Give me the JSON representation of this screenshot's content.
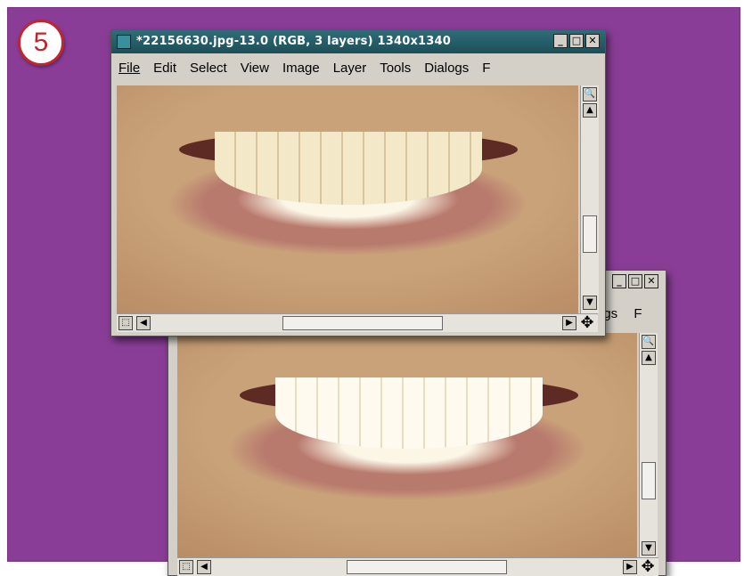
{
  "step_badge": "5",
  "front_window": {
    "title": "*22156630.jpg-13.0 (RGB, 3 layers) 1340x1340",
    "title_buttons": [
      "_",
      "□",
      "✕"
    ],
    "menu": [
      "File",
      "Edit",
      "Select",
      "View",
      "Image",
      "Layer",
      "Tools",
      "Dialogs",
      "F"
    ]
  },
  "back_window": {
    "title_buttons": [
      "_",
      "□",
      "✕"
    ],
    "menu_partial": [
      "ogs",
      "F"
    ]
  },
  "icons": {
    "zoom": "🔍",
    "scroll_up": "▲",
    "scroll_down": "▼",
    "scroll_left": "◀",
    "scroll_right": "▶",
    "navigate": "✥",
    "quick_mask": "⬚"
  },
  "colors": {
    "background": "#8a3d97",
    "badge_ring": "#c0262d",
    "titlebar": "#2e6d78"
  }
}
